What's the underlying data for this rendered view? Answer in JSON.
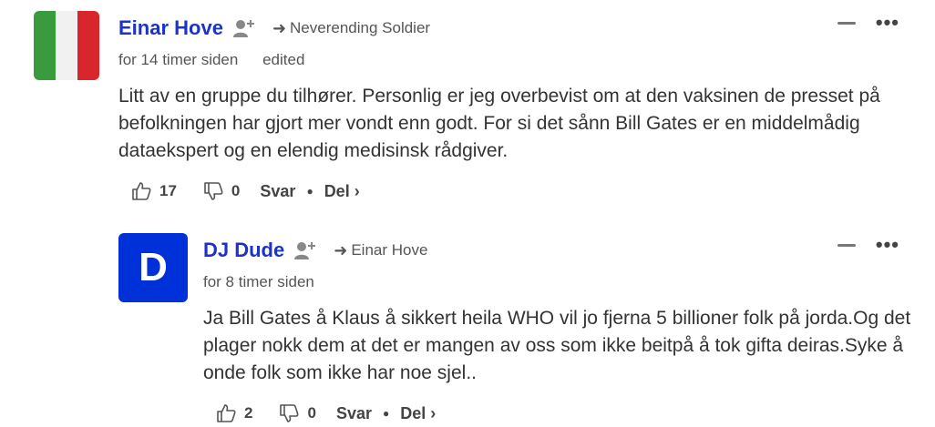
{
  "comments": [
    {
      "author": "Einar Hove",
      "avatar_icon": "italy-flag-avatar",
      "avatar_colors": [
        "#3a9a3e",
        "#f4f4f4",
        "#d8262c"
      ],
      "reply_to": "Neverending Soldier",
      "time": "for 14 timer siden",
      "edited": "edited",
      "body": "Litt av en gruppe du tilhører. Personlig er jeg overbevist om at den vaksinen de presset på befolkningen har gjort mer vondt enn godt. For si det sånn Bill Gates er en middelmådig dataekspert og en elendig medisinsk rådgiver.",
      "likes": "17",
      "dislikes": "0",
      "reply_label": "Svar",
      "share_label": "Del ›"
    },
    {
      "author": "DJ Dude",
      "avatar_letter": "D",
      "avatar_color": "#0031d8",
      "reply_to": "Einar Hove",
      "time": "for 8 timer siden",
      "body": "Ja Bill Gates å Klaus å sikkert heila WHO vil jo fjerna 5 billioner folk på jorda.Og det plager nokk dem at det er mangen av oss som ikke beitpå å tok gifta deiras.Syke å onde folk som ikke har noe sjel..",
      "likes": "2",
      "dislikes": "0",
      "reply_label": "Svar",
      "share_label": "Del ›"
    }
  ],
  "icons": {
    "follow": "add-user-icon",
    "reply_to": "arrow-right-icon",
    "collapse": "minus-icon",
    "more": "more-options-icon",
    "like": "thumbs-up-icon",
    "dislike": "thumbs-down-icon"
  }
}
